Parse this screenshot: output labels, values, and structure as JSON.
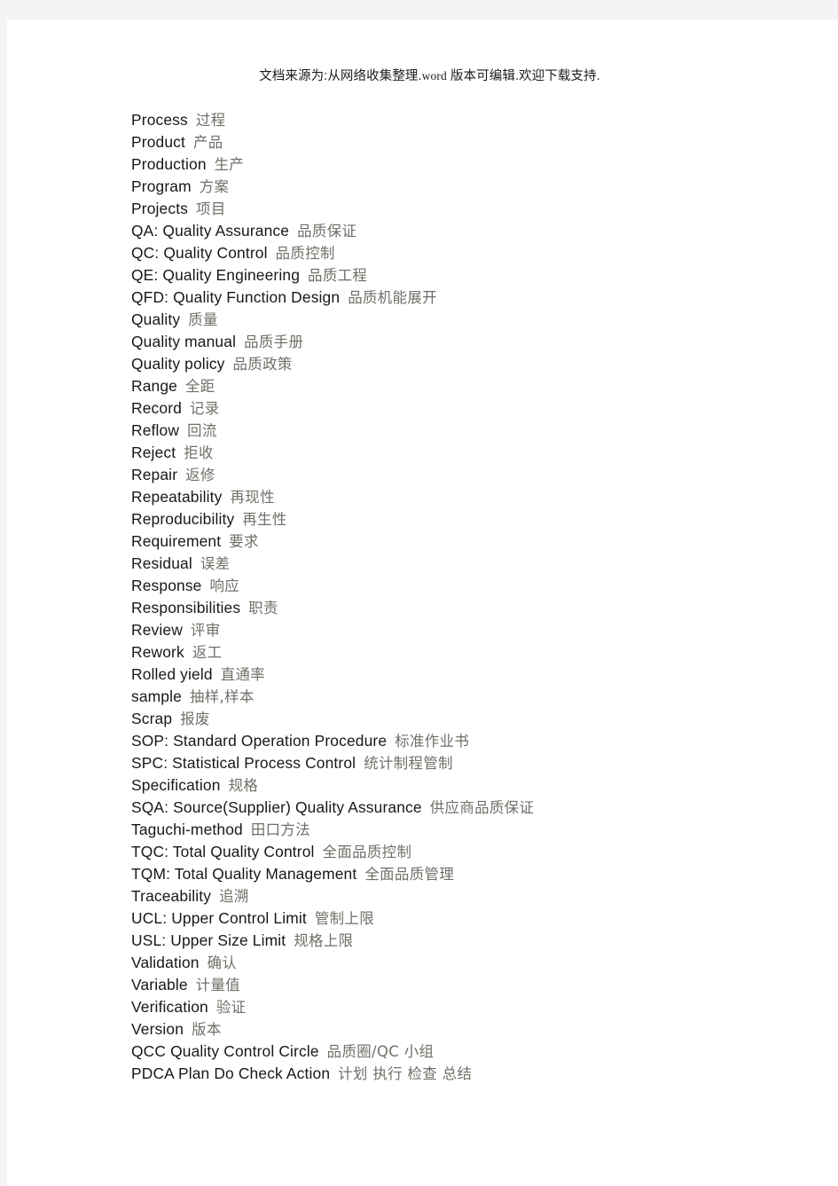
{
  "document": {
    "header_note": "文档来源为:从网络收集整理.word 版本可编辑.欢迎下载支持.",
    "header_note_parts": {
      "before": "文档来源为:从网络收集整理.",
      "word": "word",
      "after": " 版本可编辑.欢迎下载支持."
    },
    "colors": {
      "page_background": "#ffffff",
      "scan_edge": "#f4f4f4",
      "english_text": "#16181c",
      "chinese_text": "#6f6f68"
    }
  },
  "glossary": {
    "entries": [
      {
        "en": "Process",
        "cn": "过程"
      },
      {
        "en": "Product",
        "cn": "产品"
      },
      {
        "en": "Production",
        "cn": "生产"
      },
      {
        "en": "Program",
        "cn": "方案"
      },
      {
        "en": "Projects",
        "cn": "项目"
      },
      {
        "en": "QA: Quality Assurance",
        "cn": "品质保证"
      },
      {
        "en": "QC: Quality Control",
        "cn": "品质控制"
      },
      {
        "en": "QE: Quality Engineering",
        "cn": "品质工程"
      },
      {
        "en": "QFD: Quality Function Design",
        "cn": "品质机能展开"
      },
      {
        "en": "Quality",
        "cn": "质量"
      },
      {
        "en": "Quality manual",
        "cn": "品质手册"
      },
      {
        "en": "Quality policy",
        "cn": "品质政策"
      },
      {
        "en": "Range",
        "cn": "全距"
      },
      {
        "en": "Record",
        "cn": "记录"
      },
      {
        "en": "Reflow",
        "cn": "回流"
      },
      {
        "en": "Reject",
        "cn": "拒收"
      },
      {
        "en": "Repair",
        "cn": "返修"
      },
      {
        "en": "Repeatability",
        "cn": "再现性"
      },
      {
        "en": "Reproducibility",
        "cn": "再生性"
      },
      {
        "en": "Requirement",
        "cn": "要求"
      },
      {
        "en": "Residual",
        "cn": "误差"
      },
      {
        "en": "Response",
        "cn": "响应"
      },
      {
        "en": "Responsibilities",
        "cn": "职责"
      },
      {
        "en": "Review",
        "cn": "评审"
      },
      {
        "en": "Rework",
        "cn": "返工"
      },
      {
        "en": "Rolled yield",
        "cn": "直通率"
      },
      {
        "en": "sample",
        "cn": "抽样,样本"
      },
      {
        "en": "Scrap",
        "cn": "报废"
      },
      {
        "en": "SOP: Standard Operation Procedure",
        "cn": "标准作业书"
      },
      {
        "en": "SPC: Statistical Process Control",
        "cn": "统计制程管制"
      },
      {
        "en": "Specification",
        "cn": "规格"
      },
      {
        "en": "SQA: Source(Supplier) Quality Assurance",
        "cn": "供应商品质保证"
      },
      {
        "en": "Taguchi-method",
        "cn": "田口方法"
      },
      {
        "en": "TQC: Total Quality Control",
        "cn": "全面品质控制"
      },
      {
        "en": "TQM: Total Quality Management",
        "cn": "全面品质管理"
      },
      {
        "en": "Traceability",
        "cn": "追溯"
      },
      {
        "en": "UCL: Upper Control Limit",
        "cn": "管制上限"
      },
      {
        "en": "USL: Upper Size Limit",
        "cn": "规格上限"
      },
      {
        "en": "Validation",
        "cn": "确认"
      },
      {
        "en": "Variable",
        "cn": "计量值"
      },
      {
        "en": "Verification",
        "cn": "验证"
      },
      {
        "en": "Version",
        "cn": "版本"
      },
      {
        "en": "QCC Quality Control Circle",
        "cn": "品质圈/QC 小组"
      },
      {
        "en": "PDCA Plan Do Check Action",
        "cn": "计划 执行 检查 总结"
      }
    ]
  }
}
